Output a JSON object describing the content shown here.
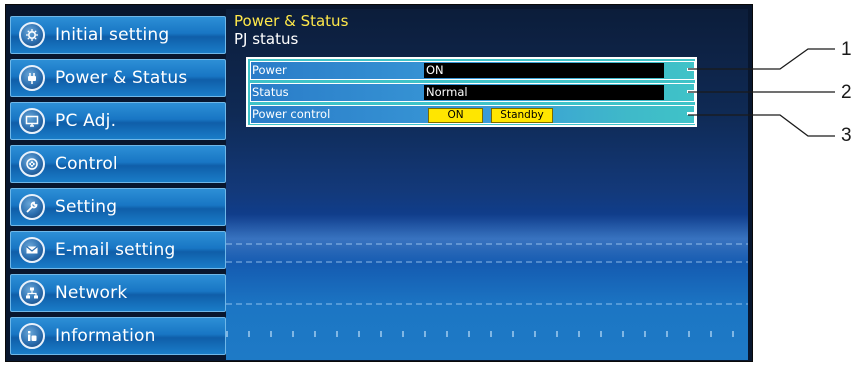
{
  "sidebar": {
    "items": [
      {
        "label": "Initial setting",
        "icon": "gear-sparkle-icon"
      },
      {
        "label": "Power & Status",
        "icon": "plug-icon"
      },
      {
        "label": "PC Adj.",
        "icon": "monitor-icon"
      },
      {
        "label": "Control",
        "icon": "control-pad-icon"
      },
      {
        "label": "Setting",
        "icon": "wrench-icon"
      },
      {
        "label": "E-mail setting",
        "icon": "envelope-icon"
      },
      {
        "label": "Network",
        "icon": "network-icon"
      },
      {
        "label": "Information",
        "icon": "info-icon"
      }
    ]
  },
  "main": {
    "section_title": "Power & Status",
    "subtitle": "PJ status",
    "rows": {
      "power": {
        "label": "Power",
        "value": "ON"
      },
      "status": {
        "label": "Status",
        "value": "Normal"
      },
      "power_control": {
        "label": "Power control",
        "on_label": "ON",
        "standby_label": "Standby"
      }
    }
  },
  "callouts": [
    "1",
    "2",
    "3"
  ],
  "colors": {
    "section_title": "#ffe84a",
    "nav_blue": "#1876c4",
    "table_teal": "#3fc3c8",
    "button_yellow": "#ffe600"
  }
}
